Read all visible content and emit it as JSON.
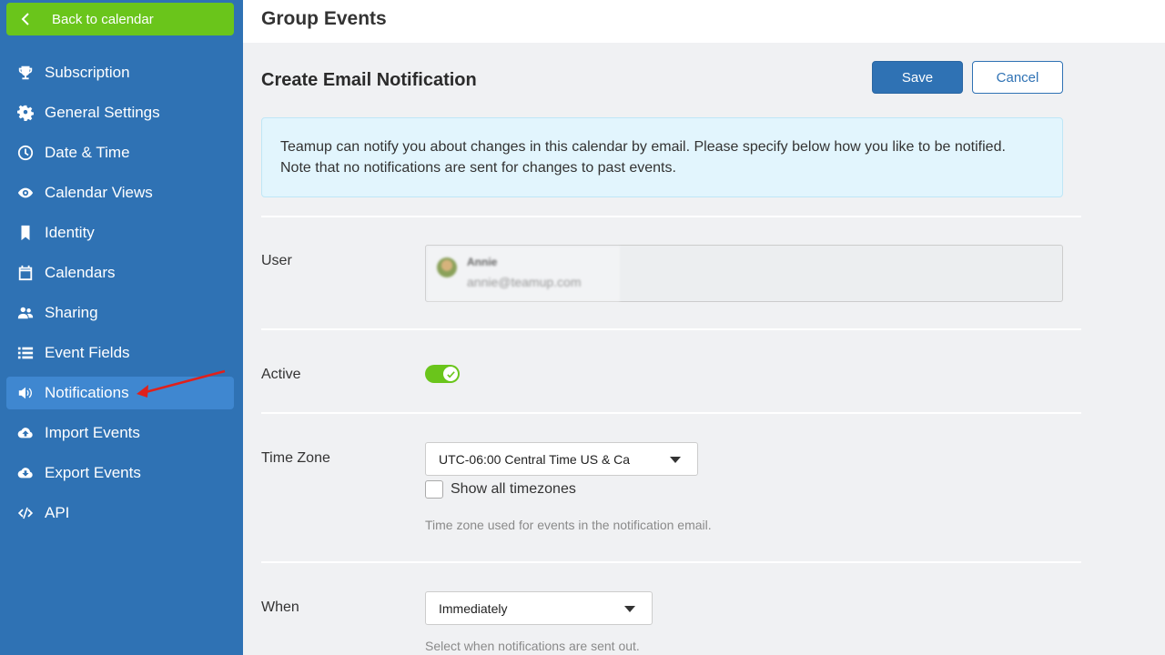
{
  "sidebar": {
    "back_label": "Back to calendar",
    "items": [
      {
        "label": "Subscription",
        "icon": "trophy-icon"
      },
      {
        "label": "General Settings",
        "icon": "gear-icon"
      },
      {
        "label": "Date & Time",
        "icon": "clock-icon"
      },
      {
        "label": "Calendar Views",
        "icon": "eye-icon"
      },
      {
        "label": "Identity",
        "icon": "bookmark-icon"
      },
      {
        "label": "Calendars",
        "icon": "calendar-icon"
      },
      {
        "label": "Sharing",
        "icon": "users-icon"
      },
      {
        "label": "Event Fields",
        "icon": "list-icon"
      },
      {
        "label": "Notifications",
        "icon": "megaphone-icon",
        "active": true
      },
      {
        "label": "Import Events",
        "icon": "cloud-upload-icon"
      },
      {
        "label": "Export Events",
        "icon": "cloud-download-icon"
      },
      {
        "label": "API",
        "icon": "code-icon"
      }
    ]
  },
  "header": {
    "title": "Group Events"
  },
  "main": {
    "title": "Create Email Notification",
    "save_label": "Save",
    "cancel_label": "Cancel",
    "info_line1": "Teamup can notify you about changes in this calendar by email. Please specify below how you like to be notified.",
    "info_line2": "Note that no notifications are sent for changes to past events.",
    "user": {
      "label": "User",
      "name": "Annie",
      "email": "annie@teamup.com"
    },
    "active": {
      "label": "Active",
      "on": true
    },
    "timezone": {
      "label": "Time Zone",
      "value": "UTC-06:00 Central Time US & Ca",
      "show_all_label": "Show all timezones",
      "help": "Time zone used for events in the notification email."
    },
    "when": {
      "label": "When",
      "value": "Immediately",
      "help": "Select when notifications are sent out."
    }
  },
  "colors": {
    "sidebar": "#2f72b4",
    "sidebar_active": "#3f87d0",
    "back_button": "#6ac51b",
    "primary": "#2f72b4",
    "toggle_on": "#6ac51b",
    "info_bg": "#e2f5fd",
    "annotation_arrow": "#e0201b"
  }
}
